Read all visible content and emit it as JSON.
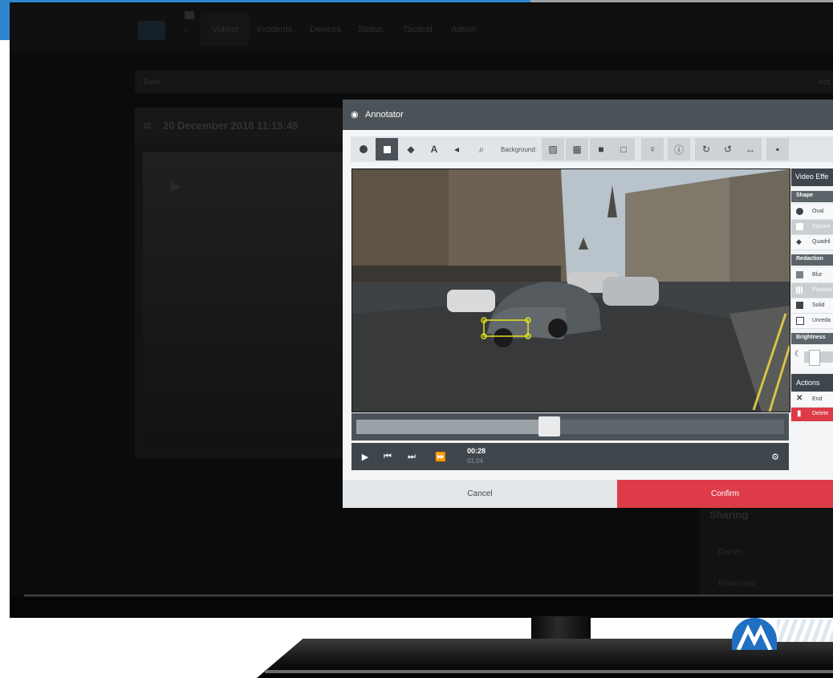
{
  "app_nav": {
    "items": [
      "Videos",
      "Incidents",
      "Devices",
      "Status",
      "Tactical",
      "Admin"
    ],
    "back_label": "‹ Back",
    "video_title": "20 December 2018 11:15:45",
    "right_cut": "Acti"
  },
  "sharing": {
    "title": "Sharing",
    "owner_label": "Owner:",
    "restricted_label": "Restricted:"
  },
  "annotator": {
    "title": "Annotator",
    "toolbar": {
      "tools": [
        "circle-tool-icon",
        "square-tool-icon",
        "diamond-tool-icon",
        "text-tool-icon",
        "audio-tool-icon",
        "zoom-tool-icon"
      ],
      "background_label": "Background:",
      "background_tools": [
        "image-bg-icon",
        "pixelate-bg-icon",
        "solid-bg-icon",
        "empty-bg-icon"
      ],
      "extra_tools": [
        "bulb-icon",
        "info-icon",
        "redo-icon",
        "undo-icon",
        "swap-icon",
        "comment-icon"
      ],
      "active_tool": "square-tool-icon"
    },
    "player": {
      "current_time": "00:28",
      "total_time": "01:04",
      "progress": 0.45
    },
    "video_effects": {
      "title": "Video Effe",
      "shape_head": "Shape",
      "shapes": [
        "Oval",
        "Square",
        "Quadril"
      ],
      "selected_shape": "Square",
      "redaction_head": "Redaction",
      "redactions": [
        "Blur",
        "Pixelate",
        "Solid",
        "Unreda"
      ],
      "selected_redaction": "Pixelate",
      "brightness_head": "Brightness"
    },
    "actions": {
      "title": "Actions",
      "end_label": "End",
      "delete_label": "Delete"
    },
    "footer": {
      "cancel_label": "Cancel",
      "confirm_label": "Confirm"
    }
  },
  "colors": {
    "confirm": "#dd3b48",
    "header": "#4b5358",
    "brand_blue": "#1f6fc2"
  }
}
